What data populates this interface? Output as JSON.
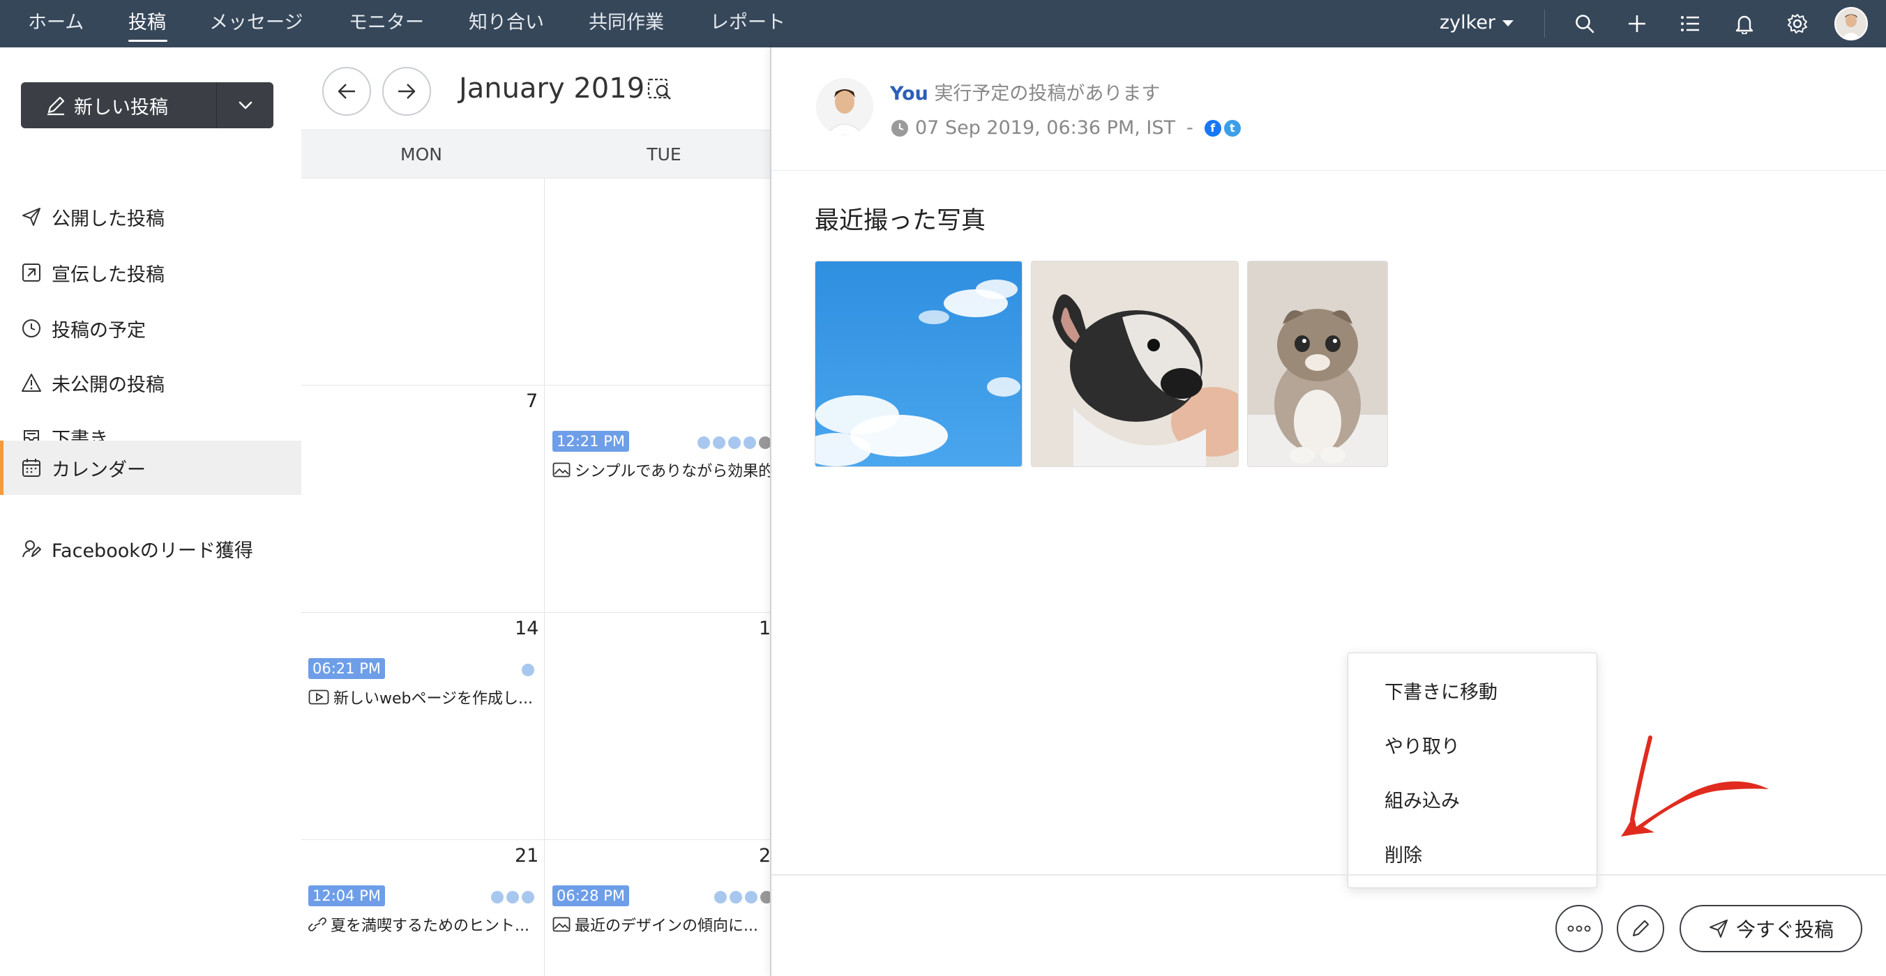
{
  "topnav": {
    "items": [
      "ホーム",
      "投稿",
      "メッセージ",
      "モニター",
      "知り合い",
      "共同作業",
      "レポート"
    ],
    "active_index": 1,
    "brand": "zylker"
  },
  "sidebar": {
    "new_post_label": "新しい投稿",
    "items": [
      {
        "label": "公開した投稿",
        "icon": "send-icon"
      },
      {
        "label": "宣伝した投稿",
        "icon": "boost-icon"
      },
      {
        "label": "投稿の予定",
        "icon": "clock-icon"
      },
      {
        "label": "未公開の投稿",
        "icon": "warning-icon"
      },
      {
        "label": "下書き",
        "icon": "drafts-icon"
      },
      {
        "label": "カレンダー",
        "icon": "calendar-icon"
      },
      {
        "label": "Facebookのリード獲得",
        "icon": "lead-icon"
      }
    ],
    "active_index": 5,
    "accent_color": "#f39a3d"
  },
  "calendar": {
    "title": "January 2019",
    "day_headers": [
      "MON",
      "TUE"
    ],
    "day_numbers": [
      "7",
      "14",
      "1",
      "21",
      "2"
    ],
    "posts": [
      {
        "time": "12:21 PM",
        "text": "シンプルでありながら効果的...",
        "type": "image"
      },
      {
        "time": "06:21 PM",
        "text": "新しいwebページを作成し...",
        "type": "video"
      },
      {
        "time": "12:04 PM",
        "text": "夏を満喫するためのヒント...",
        "type": "link"
      },
      {
        "time": "06:28 PM",
        "text": "最近のデザインの傾向に...",
        "type": "image"
      }
    ],
    "badge_color": "#6e9ee8"
  },
  "detail": {
    "user": "You",
    "status_text": "実行予定の投稿があります",
    "datetime": "07 Sep 2019, 06:36 PM, IST",
    "separator": "-",
    "networks": [
      "facebook",
      "twitter"
    ],
    "caption": "最近撮った写真",
    "photos": [
      "sky-photo",
      "dog-photo",
      "cat-photo"
    ]
  },
  "menu": {
    "items": [
      "下書きに移動",
      "やり取り",
      "組み込み",
      "削除"
    ]
  },
  "footer": {
    "post_now_label": "今すぐ投稿"
  }
}
